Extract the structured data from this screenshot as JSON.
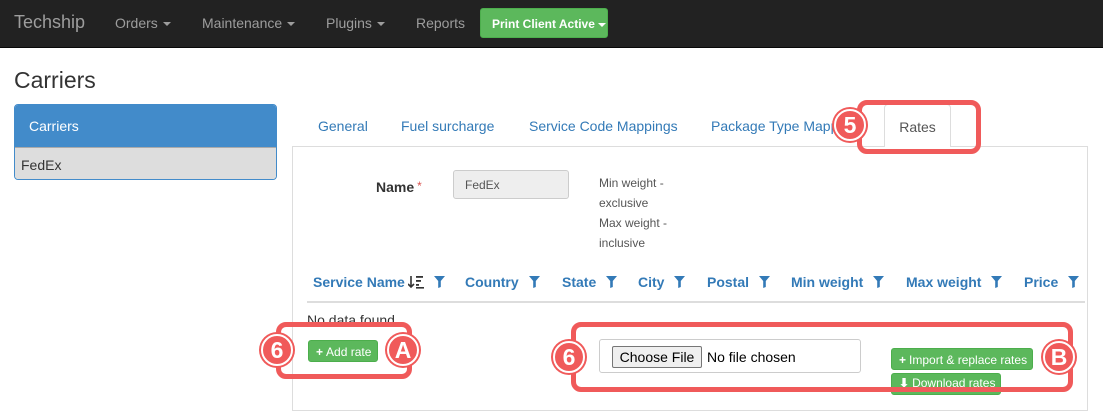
{
  "navbar": {
    "brand": "Techship",
    "items": [
      {
        "label": "Orders",
        "has_caret": true
      },
      {
        "label": "Maintenance",
        "has_caret": true
      },
      {
        "label": "Plugins",
        "has_caret": true
      },
      {
        "label": "Reports",
        "has_caret": false
      }
    ],
    "print_button": "Print Client Active"
  },
  "page": {
    "title": "Carriers"
  },
  "sidebar": {
    "header": "Carriers",
    "items": [
      {
        "label": "FedEx",
        "selected": true
      }
    ]
  },
  "tabs": {
    "items": [
      "General",
      "Fuel surcharge",
      "Service Code Mappings",
      "Package Type Mapp"
    ],
    "active": "Rates"
  },
  "form": {
    "name_label": "Name",
    "required_mark": "*",
    "name_value": "FedEx",
    "hint_lines": [
      "Min weight -",
      "exclusive",
      "Max weight -",
      "inclusive"
    ]
  },
  "grid": {
    "columns": [
      "Service Name",
      "Country",
      "State",
      "City",
      "Postal",
      "Min weight",
      "Max weight",
      "Price"
    ],
    "empty_text": "No data found."
  },
  "actions": {
    "add_rate": "Add rate",
    "choose_file": "Choose File",
    "no_file": "No file chosen",
    "import_replace": "Import & replace rates",
    "download": "Download rates"
  },
  "annotations": {
    "badge_5": "5",
    "badge_6a": "6",
    "badge_a": "A",
    "badge_6b": "6",
    "badge_b": "B"
  },
  "colors": {
    "navbar_bg": "#222222",
    "success_green": "#5cb85c",
    "primary_blue": "#428bca",
    "link_blue": "#337ab7",
    "annotation_red": "#f05a5a"
  }
}
